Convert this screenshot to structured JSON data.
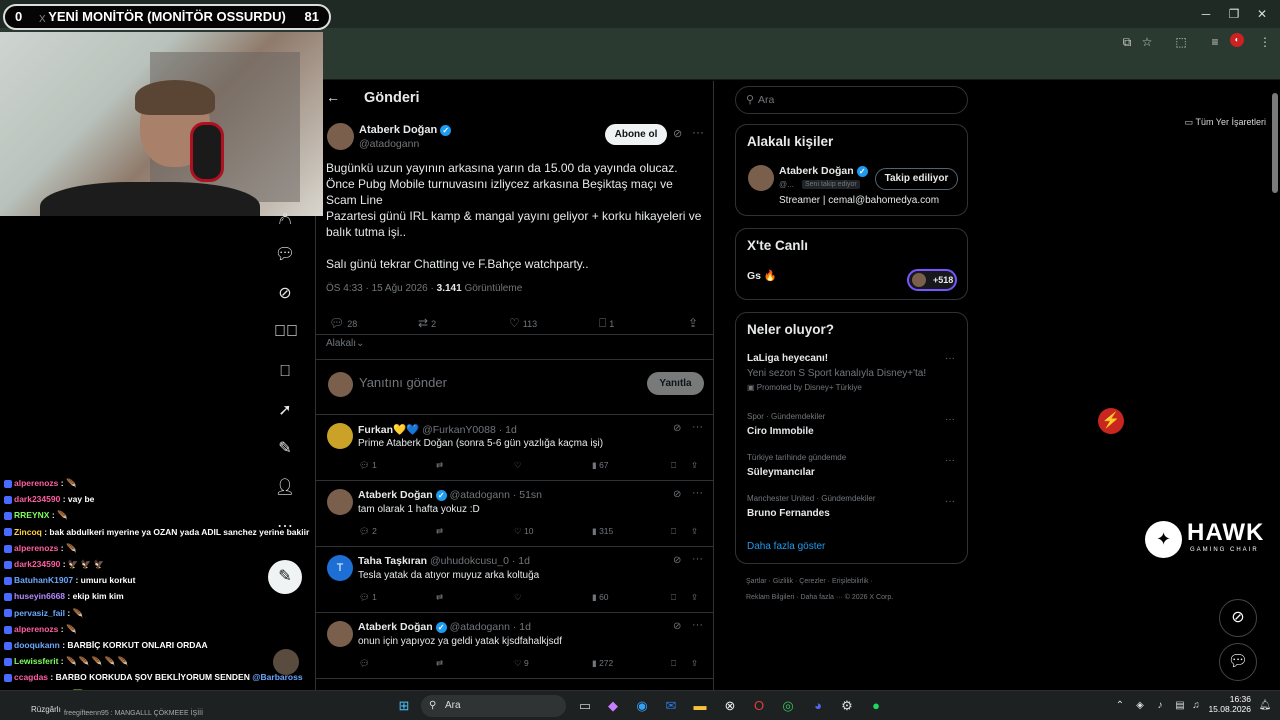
{
  "browser": {
    "bookmarks_label": "Tüm Yer İşaretleri",
    "window_controls": [
      "minimize",
      "maximize",
      "close"
    ]
  },
  "stream": {
    "score_left": "0",
    "score_right": "81",
    "title": "YENİ MONİTÖR (MONİTÖR OSSURDU)",
    "tab_peek": "X"
  },
  "chat": [
    {
      "user": "alperenozs",
      "msg": ":",
      "color": "#ff5fa2",
      "icon": "🪶"
    },
    {
      "user": "dark234590",
      "msg": ": vay be",
      "color": "#ff5fa2"
    },
    {
      "user": "RREYNX",
      "msg": ":",
      "color": "#7dff5a",
      "icon": "🪶"
    },
    {
      "user": "Zincoq",
      "msg": ": bak abdulkeri myerine ya OZAN yada ADIL sanchez yerine bakiir",
      "color": "#ffd23f"
    },
    {
      "user": "alperenozs",
      "msg": ":",
      "color": "#ff5fa2",
      "icon": "🪶"
    },
    {
      "user": "dark234590",
      "msg": ": 🦅 🦅 🦅",
      "color": "#ff5fa2"
    },
    {
      "user": "BatuhanK1907",
      "msg": ": umuru korkut",
      "color": "#6aa8ff"
    },
    {
      "user": "huseyin6668",
      "msg": ": ekip kim kim",
      "color": "#b48cff"
    },
    {
      "user": "pervasiz_fail",
      "msg": ":",
      "color": "#6aa8ff",
      "icon": "🪶"
    },
    {
      "user": "alperenozs",
      "msg": ":",
      "color": "#ff5fa2",
      "icon": "🪶"
    },
    {
      "user": "dooqukann",
      "msg": ": BARBİÇ KORKUT ONLARI ORDAA",
      "color": "#6aa8ff"
    },
    {
      "user": "Lewissferit",
      "msg": ": 🪶 🪶 🪶 🪶 🪶",
      "color": "#7dff5a"
    },
    {
      "user": "ccagdas",
      "msg": ": BARBO KORKUDA ŞOV BEKLİYORUM SENDEN",
      "color": "#ff5fa2",
      "mention": "@Barbaross"
    },
    {
      "user": "pervasiz_fail",
      "msg": ":",
      "color": "#6aa8ff",
      "icon": "🟩"
    }
  ],
  "main": {
    "header": "Gönderi",
    "post": {
      "author": "Ataberk Doğan",
      "handle": "@atadogann",
      "subscribe_label": "Abone ol",
      "para1": "Bugünkü uzun yayının arkasına yarın da 15.00 da yayında olucaz. Önce Pubg Mobile turnuvasını izliycez arkasına Beşiktaş maçı ve Scam Line",
      "para2": "Pazartesi günü IRL kamp & mangal yayını geliyor + korku hikayeleri ve balık tutma işi..",
      "para3": "Salı günü tekrar Chatting ve F.Bahçe watchparty..",
      "meta_time": "ÖS 4:33 · 15 Ağu 2026 ·",
      "meta_views_num": "3.141",
      "meta_views_label": "Görüntüleme",
      "replies": "28",
      "reposts": "2",
      "likes": "113",
      "bookmarks": "1"
    },
    "sort_label": "Alakalı",
    "reply_placeholder": "Yanıtını gönder",
    "reply_button": "Yanıtla",
    "replies": [
      {
        "name": "Furkan💛💙",
        "handle": "@FurkanY0088 · 1d",
        "text": "Prime Ataberk Doğan (sonra 5-6 gün yazlığa kaçma işi)",
        "replies": "1",
        "reposts": "",
        "likes": "",
        "views": "67",
        "verified": false,
        "avatar": "#c9a227"
      },
      {
        "name": "Ataberk Doğan",
        "handle": "@atadogann · 51sn",
        "text": "tam olarak 1 hafta yokuz :D",
        "replies": "2",
        "reposts": "",
        "likes": "10",
        "views": "315",
        "verified": true,
        "avatar": "#7a5f4c"
      },
      {
        "name": "Taha Taşkıran",
        "handle": "@uhudokcusu_0 · 1d",
        "text": "Tesla yatak da atıyor muyuz arka koltuğa",
        "replies": "1",
        "reposts": "",
        "likes": "",
        "views": "60",
        "verified": false,
        "avatar": "#1d6fd6",
        "initial": "T"
      },
      {
        "name": "Ataberk Doğan",
        "handle": "@atadogann · 1d",
        "text": "onun için yapıyoz ya geldi yatak kjsdfahalkjsdf",
        "replies": "",
        "reposts": "",
        "likes": "9",
        "views": "272",
        "verified": true,
        "avatar": "#7a5f4c"
      }
    ]
  },
  "right": {
    "search_placeholder": "Ara",
    "relevant_title": "Alakalı kişiler",
    "rp_name": "Ataberk Doğan",
    "rp_handle": "@...",
    "rp_follows_you": "Seni takip ediyor",
    "rp_button": "Takip ediliyor",
    "rp_bio": "Streamer | cemal@bahomedya.com",
    "live_title": "X'te Canlı",
    "live_text": "Gs 🔥",
    "live_count": "+518",
    "trends_title": "Neler oluyor?",
    "trends": [
      {
        "cat": "",
        "name": "LaLiga heyecanı!",
        "sub": "Yeni sezon S Sport kanalıyla Disney+'ta!",
        "promo": "Promoted by Disney+ Türkiye"
      },
      {
        "cat": "Spor · Gündemdekiler",
        "name": "Ciro Immobile"
      },
      {
        "cat": "Türkiye tarihinde gündemde",
        "name": "Süleymancılar"
      },
      {
        "cat": "Manchester United · Gündemdekiler",
        "name": "Bruno Fernandes"
      }
    ],
    "show_more": "Daha fazla göster",
    "footer1": "Şartlar  ·   Gizlilik  ·   Çerezler  ·   Erişilebilirlik  ·",
    "footer2": "Reklam Bilgileri   ·   Daha fazla ···   © 2026 X Corp."
  },
  "overlay": {
    "brand": "HAWK",
    "brand_sub": "GAMING CHAIR"
  },
  "taskbar": {
    "search_label": "Ara",
    "weather": "Rüzgârlı",
    "chat_peek": "freegifteenn95 : MANGALLL ÇÖKMEEE İŞİİİ",
    "time": "16:36",
    "date": "15.08.2026"
  }
}
